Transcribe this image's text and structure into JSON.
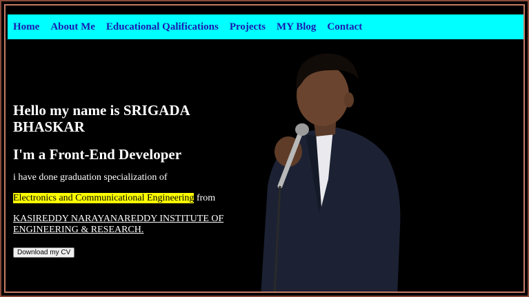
{
  "nav": {
    "items": [
      {
        "label": "Home"
      },
      {
        "label": "About Me"
      },
      {
        "label": "Educational Qalifications"
      },
      {
        "label": "Projects"
      },
      {
        "label": "MY Blog"
      },
      {
        "label": "Contact"
      }
    ]
  },
  "hero": {
    "greeting": "Hello my name is SRIGADA BHASKAR",
    "role": "I'm a Front-End Developer",
    "intro": "i have done graduation specialization of",
    "specialization": "Electronics and Communicational Engineering",
    "from_word": " from",
    "institute": "KASIREDDY NARAYANAREDDY INSTITUTE OF ENGINEERING & RESEARCH.",
    "cv_button": "Download my CV"
  },
  "colors": {
    "navbar_bg": "#00ffff",
    "nav_link": "#1a1ab0",
    "highlight": "#ffff00",
    "page_bg": "#000000"
  }
}
